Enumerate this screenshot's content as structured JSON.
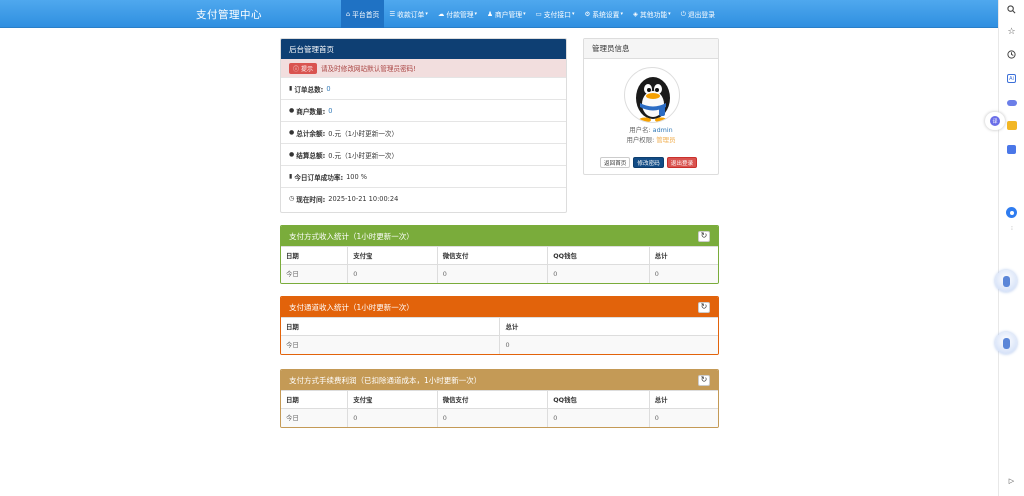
{
  "navbar": {
    "brand": "支付管理中心",
    "items": [
      {
        "label": "平台首页",
        "icon": "home-icon",
        "active": true,
        "dropdown": false
      },
      {
        "label": "收款订单",
        "icon": "list-icon",
        "active": false,
        "dropdown": true
      },
      {
        "label": "付款管理",
        "icon": "cloud-icon",
        "active": false,
        "dropdown": true
      },
      {
        "label": "商户管理",
        "icon": "user-icon",
        "active": false,
        "dropdown": true
      },
      {
        "label": "支付接口",
        "icon": "credit-card-icon",
        "active": false,
        "dropdown": true
      },
      {
        "label": "系统设置",
        "icon": "gear-icon",
        "active": false,
        "dropdown": true
      },
      {
        "label": "其他功能",
        "icon": "shield-icon",
        "active": false,
        "dropdown": true
      },
      {
        "label": "退出登录",
        "icon": "power-icon",
        "active": false,
        "dropdown": false
      }
    ]
  },
  "overview": {
    "title": "后台管理首页",
    "alert_badge": "提示",
    "alert_text": "请及时修改网站默认管理员密码!",
    "rows": [
      {
        "label": "订单总数:",
        "value": "0",
        "icon": "bar-chart-icon",
        "link": true
      },
      {
        "label": "商户数量:",
        "value": "0",
        "icon": "tint-icon",
        "link": true
      },
      {
        "label": "总计余额:",
        "value": "0.元（1小时更新一次）",
        "icon": "tint-icon",
        "link": false
      },
      {
        "label": "结算总额:",
        "value": "0.元（1小时更新一次）",
        "icon": "tint-icon",
        "link": false
      },
      {
        "label": "今日订单成功率:",
        "value": "100 %",
        "icon": "bar-chart-icon",
        "link": false
      },
      {
        "label": "现在时间:",
        "value": "2025-10-21 10:00:24",
        "icon": "clock-icon",
        "link": false
      }
    ]
  },
  "admin": {
    "title": "管理员信息",
    "username_label": "用户名:",
    "username": "admin",
    "role_label": "用户权限:",
    "role": "管理员",
    "buttons": [
      "返回首页",
      "修改密码",
      "退出登录"
    ],
    "username_color": "#337ab7",
    "role_color": "#f0ad4e"
  },
  "stats": [
    {
      "title": "支付方式收入统计（1小时更新一次）",
      "color": "#7aac3b",
      "columns": [
        "日期",
        "支付宝",
        "微信支付",
        "QQ钱包",
        "总计"
      ],
      "rows": [
        [
          "今日",
          "0",
          "0",
          "0",
          "0"
        ]
      ]
    },
    {
      "title": "支付通道收入统计（1小时更新一次）",
      "color": "#e2630b",
      "columns": [
        "日期",
        "总计"
      ],
      "rows": [
        [
          "今日",
          "0"
        ]
      ]
    },
    {
      "title": "支付方式手续费利润（已扣除通道成本，1小时更新一次）",
      "color": "#c49a56",
      "columns": [
        "日期",
        "支付宝",
        "微信支付",
        "QQ钱包",
        "总计"
      ],
      "rows": [
        [
          "今日",
          "0",
          "0",
          "0",
          "0"
        ]
      ]
    }
  ],
  "colors": {
    "navbar": "#3d9ae8",
    "overview_header": "#0e3f73",
    "alert_bg": "#f2dede"
  }
}
